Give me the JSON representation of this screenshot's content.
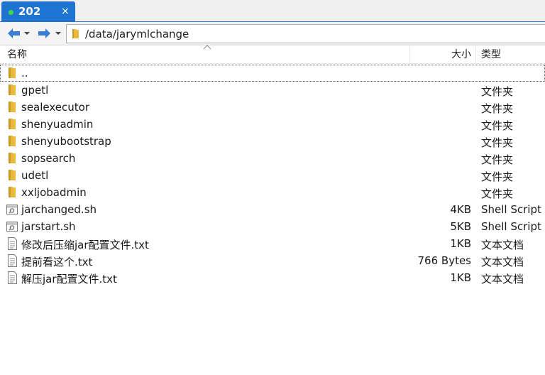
{
  "tab": {
    "label": "202",
    "close": "×",
    "status_color": "#3fd84a"
  },
  "address": {
    "path": "/data/jarymlchange"
  },
  "columns": {
    "name": "名称",
    "size": "大小",
    "type": "类型"
  },
  "files": [
    {
      "name": "..",
      "size": "",
      "type": "",
      "icon": "folder-icon"
    },
    {
      "name": "gpetl",
      "size": "",
      "type": "文件夹",
      "icon": "folder-icon"
    },
    {
      "name": "sealexecutor",
      "size": "",
      "type": "文件夹",
      "icon": "folder-icon"
    },
    {
      "name": "shenyuadmin",
      "size": "",
      "type": "文件夹",
      "icon": "folder-icon"
    },
    {
      "name": "shenyubootstrap",
      "size": "",
      "type": "文件夹",
      "icon": "folder-icon"
    },
    {
      "name": "sopsearch",
      "size": "",
      "type": "文件夹",
      "icon": "folder-icon"
    },
    {
      "name": "udetl",
      "size": "",
      "type": "文件夹",
      "icon": "folder-icon"
    },
    {
      "name": "xxljobadmin",
      "size": "",
      "type": "文件夹",
      "icon": "folder-icon"
    },
    {
      "name": "jarchanged.sh",
      "size": "4KB",
      "type": "Shell Script",
      "icon": "script-file-icon"
    },
    {
      "name": "jarstart.sh",
      "size": "5KB",
      "type": "Shell Script",
      "icon": "script-file-icon"
    },
    {
      "name": "修改后压缩jar配置文件.txt",
      "size": "1KB",
      "type": "文本文档",
      "icon": "text-file-icon"
    },
    {
      "name": "提前看这个.txt",
      "size": "766 Bytes",
      "type": "文本文档",
      "icon": "text-file-icon"
    },
    {
      "name": "解压jar配置文件.txt",
      "size": "1KB",
      "type": "文本文档",
      "icon": "text-file-icon"
    }
  ],
  "colors": {
    "tab_active": "#1e74d0",
    "folder": "#e8b93a",
    "nav_arrow": "#3b7fd4"
  }
}
